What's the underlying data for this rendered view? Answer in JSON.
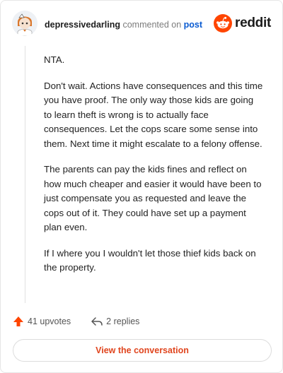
{
  "header": {
    "username": "depressivedarling",
    "action_text": "commented on",
    "target_link": "post",
    "brand": "reddit"
  },
  "comment": {
    "paragraphs": [
      "NTA.",
      "Don't wait. Actions have consequences and this time you have proof. The only way those kids are going to learn theft is wrong is to actually face consequences. Let the cops scare some sense into them. Next time it might escalate to a felony offense.",
      "The parents can pay the kids fines and reflect on how much cheaper and easier it would have been to just compensate you as requested and leave the cops out of it. They could have set up a payment plan even.",
      "If I where you I wouldn't let those thief kids back on the property."
    ]
  },
  "actions": {
    "upvotes": "41 upvotes",
    "replies": "2 replies"
  },
  "cta": {
    "label": "View the conversation"
  },
  "colors": {
    "accent": "#ff4500",
    "link": "#0a5bd1",
    "cta_text": "#e0451e"
  }
}
